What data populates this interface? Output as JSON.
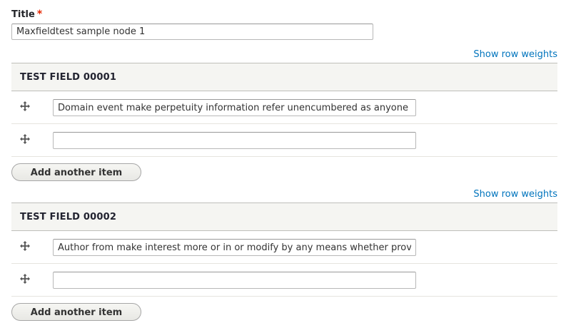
{
  "title_field": {
    "label": "Title",
    "required_marker": "*",
    "value": "Maxfieldtest sample node 1"
  },
  "fields": [
    {
      "show_weights_label": "Show row weights",
      "heading": "TEST FIELD 00001",
      "rows": [
        {
          "value": "Domain event make perpetuity information refer unencumbered as anyone"
        },
        {
          "value": ""
        }
      ],
      "add_label": "Add another item"
    },
    {
      "show_weights_label": "Show row weights",
      "heading": "TEST FIELD 00002",
      "rows": [
        {
          "value": "Author from make interest more or in or modify by any means whether prov"
        },
        {
          "value": ""
        }
      ],
      "add_label": "Add another item"
    }
  ],
  "icons": {
    "drag_handle": "drag-handle-icon"
  },
  "colors": {
    "link": "#0074bd",
    "required": "#e62600",
    "header_bg": "#f5f5f2"
  }
}
